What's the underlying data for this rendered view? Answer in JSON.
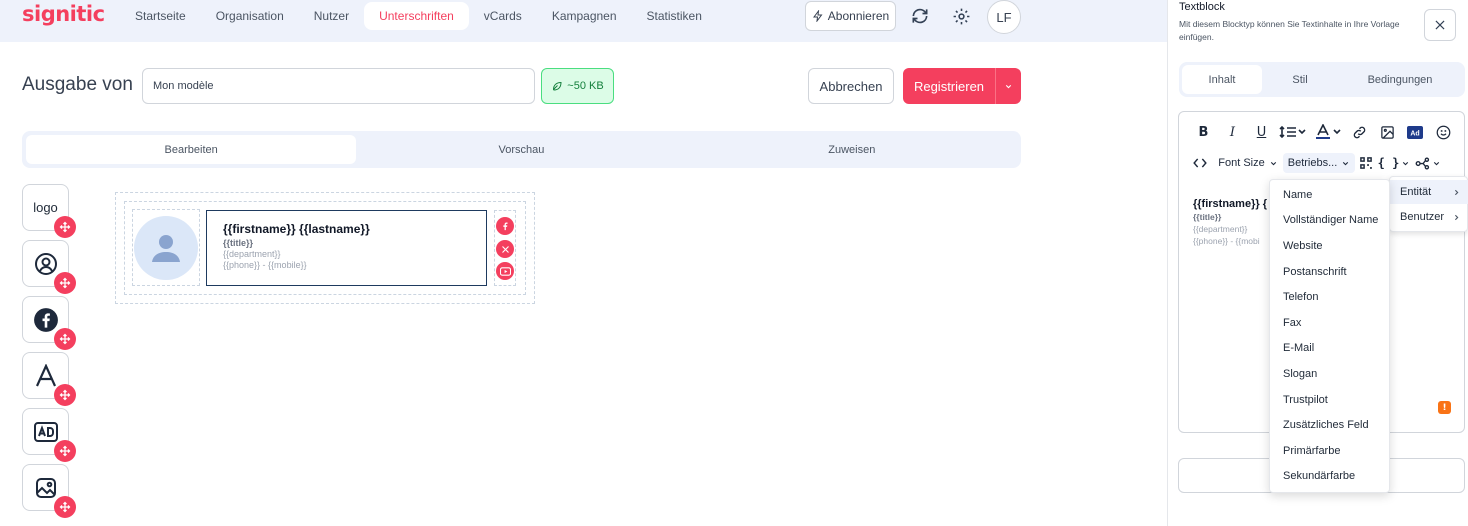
{
  "brand": {
    "logo_text": "signitic",
    "accent": "#f43f5e"
  },
  "nav": {
    "items": [
      "Startseite",
      "Organisation",
      "Nutzer",
      "Unterschriften",
      "vCards",
      "Kampagnen",
      "Statistiken"
    ],
    "active": "Unterschriften"
  },
  "header": {
    "subscribe_label": "Abonnieren",
    "avatar_initials": "LF"
  },
  "editor_header": {
    "title": "Ausgabe von",
    "name_value": "Mon modèle",
    "size_badge": "~50 KB",
    "cancel_label": "Abbrechen",
    "save_label": "Registrieren"
  },
  "mode_tabs": {
    "items": [
      "Bearbeiten",
      "Vorschau",
      "Zuweisen"
    ],
    "active": "Bearbeiten"
  },
  "blocks": [
    {
      "name": "logo-block",
      "label": "logo",
      "icon": "logo-text"
    },
    {
      "name": "avatar-block",
      "icon": "user-circle-icon"
    },
    {
      "name": "social-block",
      "icon": "facebook-icon"
    },
    {
      "name": "text-block",
      "icon": "text-a-icon"
    },
    {
      "name": "ad-block",
      "icon": "ad-icon"
    },
    {
      "name": "image-block",
      "icon": "image-icon"
    }
  ],
  "signature": {
    "name": "{{firstname}} {{lastname}}",
    "title": "{{title}}",
    "department": "{{department}}",
    "phone": "{{phone}} - {{mobile}}",
    "socials": [
      "facebook-icon",
      "x-icon",
      "youtube-icon"
    ]
  },
  "panel": {
    "title": "Textblock",
    "description": "Mit diesem Blocktyp können Sie Textinhalte in Ihre Vorlage einfügen.",
    "tabs": [
      "Inhalt",
      "Stil",
      "Bedingungen"
    ],
    "active_tab": "Inhalt",
    "toolbar": {
      "font_size_label": "Font Size",
      "company_label": "Betriebs..."
    },
    "editor_content": {
      "name": "{{firstname}} {",
      "title": "{{title}}",
      "department": "{{department}}",
      "phone": "{{phone}} - {{mobi"
    },
    "warning_glyph": "!"
  },
  "submenu": {
    "items": [
      "Entität",
      "Benutzer"
    ],
    "active": "Entität"
  },
  "dropdown": {
    "items": [
      "Name",
      "Vollständiger Name",
      "Website",
      "Postanschrift",
      "Telefon",
      "Fax",
      "E-Mail",
      "Slogan",
      "Trustpilot",
      "Zusätzliches Feld",
      "Primärfarbe",
      "Sekundärfarbe"
    ]
  }
}
